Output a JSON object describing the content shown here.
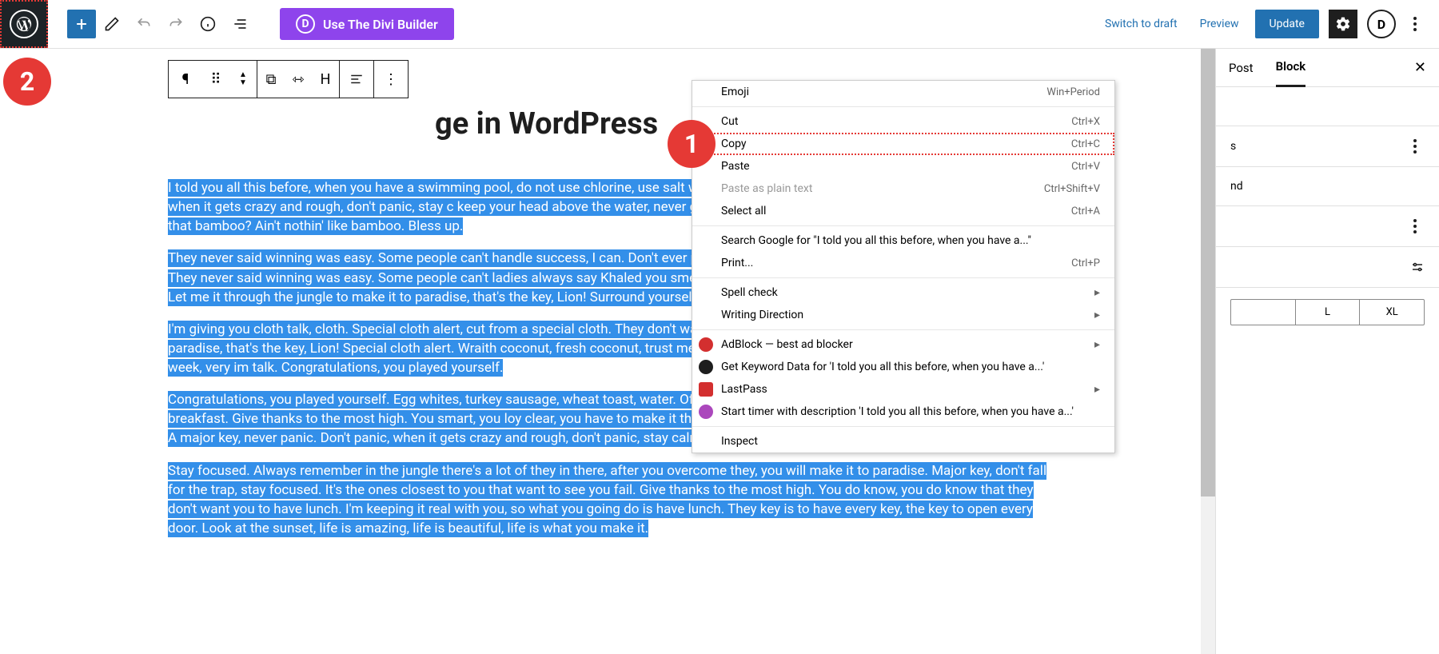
{
  "toolbar": {
    "divi_label": "Use The Divi Builder",
    "switch_draft": "Switch to draft",
    "preview": "Preview",
    "update": "Update"
  },
  "title_fragment": "ge in WordPress",
  "paragraphs": [
    "I told you all this before, when you have a swimming pool, do not use chlorine, use salt water, the healing. A major key, never panic. Don't panic, when it gets crazy and rough, don't panic, stay c keep your head above the water, never give up. Another one. Eliptical talk. You see that bamboo that bamboo? Ain't nothin' like bamboo. Bless up.",
    "They never said winning was easy. Some people can't handle success, I can. Don't ever play yoursel Celebrate success right, the only way, apple. They never said winning was easy. Some people can't ladies always say Khaled you smell good, I use no cologne. Cocoa butter is the key. Fan luv. Let me it through the jungle to make it to paradise, that's the key, Lion! Surround yourself with angels. Lion",
    "I'm giving you cloth talk, cloth. Special cloth alert, cut from a special cloth. They don't want us to win to make it through the jungle to make it to paradise, that's the key, Lion! Special cloth alert. Wraith coconut, fresh coconut, trust me. The key to more success is to get a massage once a week, very im talk. Congratulations, you played yourself.",
    "Congratulations, you played yourself. Egg whites, turkey sausage, wheat toast, water. Of course the breakfast, so we are going to enjoy our breakfast. Give thanks to the most high. You smart, you loy clear, you have to make it through the jungle to make it to paradise, that's the key, Lion! A major key, never panic. Don't panic, when it gets crazy and rough, don't panic, stay calm. Mogul talk.",
    "Stay focused. Always remember in the jungle there's a lot of they in there, after you overcome they, you will make it to paradise. Major key, don't fall for the trap, stay focused. It's the ones closest to you that want to see you fail. Give thanks to the most high. You do know, you do know that they don't want you to have lunch. I'm keeping it real with you, so what you going do is have lunch. They key is to have every key, the key to open every door. Look at the sunset, life is amazing, life is beautiful, life is what you make it."
  ],
  "ctx": {
    "emoji": "Emoji",
    "emoji_k": "Win+Period",
    "cut": "Cut",
    "cut_k": "Ctrl+X",
    "copy": "Copy",
    "copy_k": "Ctrl+C",
    "paste": "Paste",
    "paste_k": "Ctrl+V",
    "paste_plain": "Paste as plain text",
    "paste_plain_k": "Ctrl+Shift+V",
    "select_all": "Select all",
    "select_all_k": "Ctrl+A",
    "search": "Search Google for \"I told you all this before, when you have a...\"",
    "print": "Print...",
    "print_k": "Ctrl+P",
    "spell": "Spell check",
    "writing": "Writing Direction",
    "adblock": "AdBlock — best ad blocker",
    "keyword": "Get Keyword Data for 'I told you all this before, when you have a...'",
    "lastpass": "LastPass",
    "timer": "Start timer with description 'I told you all this before, when you have a...'",
    "inspect": "Inspect"
  },
  "sidebar": {
    "tab_post": "Post",
    "tab_block": "Block",
    "field_nd": "nd",
    "sizes": [
      "",
      "L",
      "XL"
    ]
  },
  "badges": {
    "one": "1",
    "two": "2"
  }
}
